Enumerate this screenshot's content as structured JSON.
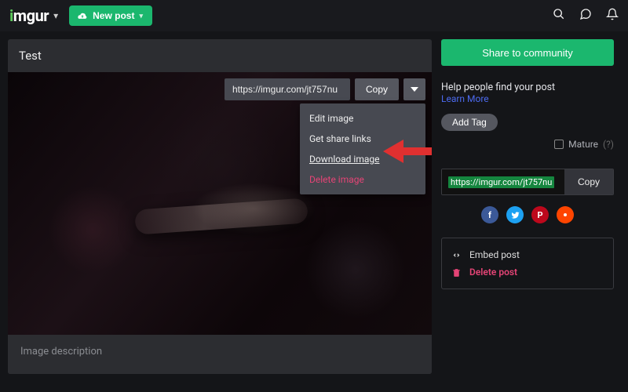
{
  "nav": {
    "logo_text": "imgur",
    "new_post": "New post"
  },
  "post": {
    "title": "Test",
    "url": "https://imgur.com/jt757nu",
    "copy_label": "Copy",
    "description_placeholder": "Image description"
  },
  "menu": {
    "edit": "Edit image",
    "share": "Get share links",
    "download": "Download image",
    "delete": "Delete image"
  },
  "right": {
    "share_button": "Share to community",
    "help_title": "Help people find your post",
    "learn_more": "Learn More",
    "add_tag": "Add Tag",
    "mature_label": "Mature",
    "mature_hint": "(?)",
    "share_url": "https://imgur.com/jt757nu",
    "copy_label": "Copy",
    "embed_label": "Embed post",
    "delete_label": "Delete post"
  }
}
